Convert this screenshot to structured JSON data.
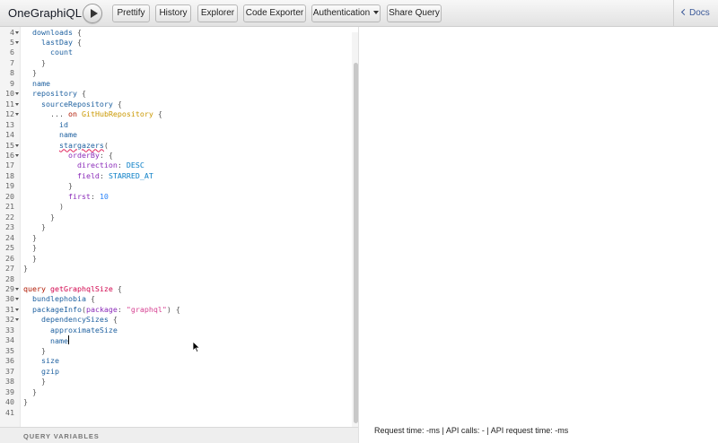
{
  "app": {
    "title": "OneGraphiQL"
  },
  "toolbar": {
    "buttons": [
      {
        "label": "Prettify"
      },
      {
        "label": "History"
      },
      {
        "label": "Explorer"
      },
      {
        "label": "Code Exporter"
      },
      {
        "label": "Authentication"
      },
      {
        "label": "Share Query"
      }
    ],
    "docs_label": "Docs"
  },
  "editor": {
    "lines": [
      {
        "n": "4",
        "fold": true,
        "indent": 1,
        "tokens": [
          [
            "field",
            "downloads"
          ],
          [
            "punct",
            " {"
          ]
        ]
      },
      {
        "n": "5",
        "fold": true,
        "indent": 2,
        "tokens": [
          [
            "field",
            "lastDay"
          ],
          [
            "punct",
            " {"
          ]
        ]
      },
      {
        "n": "6",
        "fold": false,
        "indent": 3,
        "tokens": [
          [
            "field",
            "count"
          ]
        ]
      },
      {
        "n": "7",
        "fold": false,
        "indent": 2,
        "tokens": [
          [
            "punct",
            "}"
          ]
        ]
      },
      {
        "n": "8",
        "fold": false,
        "indent": 1,
        "tokens": [
          [
            "punct",
            "}"
          ]
        ]
      },
      {
        "n": "9",
        "fold": false,
        "indent": 1,
        "tokens": [
          [
            "field",
            "name"
          ]
        ]
      },
      {
        "n": "10",
        "fold": true,
        "indent": 1,
        "tokens": [
          [
            "field",
            "repository"
          ],
          [
            "punct",
            " {"
          ]
        ]
      },
      {
        "n": "11",
        "fold": true,
        "indent": 2,
        "tokens": [
          [
            "field",
            "sourceRepository"
          ],
          [
            "punct",
            " {"
          ]
        ]
      },
      {
        "n": "12",
        "fold": true,
        "indent": 3,
        "tokens": [
          [
            "punct",
            "... "
          ],
          [
            "keyword",
            "on"
          ],
          [
            "punct",
            " "
          ],
          [
            "type",
            "GitHubRepository"
          ],
          [
            "punct",
            " {"
          ]
        ]
      },
      {
        "n": "13",
        "fold": false,
        "indent": 4,
        "tokens": [
          [
            "field",
            "id"
          ]
        ]
      },
      {
        "n": "14",
        "fold": false,
        "indent": 4,
        "tokens": [
          [
            "field",
            "name"
          ]
        ]
      },
      {
        "n": "15",
        "fold": true,
        "indent": 4,
        "tokens": [
          [
            "field-spell",
            "stargazers"
          ],
          [
            "punct",
            "("
          ]
        ]
      },
      {
        "n": "16",
        "fold": true,
        "indent": 5,
        "tokens": [
          [
            "attr",
            "orderBy"
          ],
          [
            "punct",
            ": {"
          ]
        ]
      },
      {
        "n": "17",
        "fold": false,
        "indent": 6,
        "tokens": [
          [
            "attr",
            "direction"
          ],
          [
            "punct",
            ": "
          ],
          [
            "enum",
            "DESC"
          ]
        ]
      },
      {
        "n": "18",
        "fold": false,
        "indent": 6,
        "tokens": [
          [
            "attr",
            "field"
          ],
          [
            "punct",
            ": "
          ],
          [
            "enum",
            "STARRED_AT"
          ]
        ]
      },
      {
        "n": "19",
        "fold": false,
        "indent": 5,
        "tokens": [
          [
            "punct",
            "}"
          ]
        ]
      },
      {
        "n": "20",
        "fold": false,
        "indent": 5,
        "tokens": [
          [
            "attr",
            "first"
          ],
          [
            "punct",
            ": "
          ],
          [
            "number",
            "10"
          ]
        ]
      },
      {
        "n": "21",
        "fold": false,
        "indent": 4,
        "tokens": [
          [
            "punct",
            ")"
          ]
        ]
      },
      {
        "n": "22",
        "fold": false,
        "indent": 3,
        "tokens": [
          [
            "punct",
            "}"
          ]
        ]
      },
      {
        "n": "23",
        "fold": false,
        "indent": 2,
        "tokens": [
          [
            "punct",
            "}"
          ]
        ]
      },
      {
        "n": "24",
        "fold": false,
        "indent": 1,
        "tokens": [
          [
            "punct",
            "}"
          ]
        ]
      },
      {
        "n": "25",
        "fold": false,
        "indent": 1,
        "tokens": [
          [
            "punct",
            "}"
          ]
        ]
      },
      {
        "n": "26",
        "fold": false,
        "indent": 1,
        "tokens": [
          [
            "punct",
            "}"
          ]
        ]
      },
      {
        "n": "27",
        "fold": false,
        "indent": 0,
        "tokens": [
          [
            "punct",
            "}"
          ]
        ]
      },
      {
        "n": "28",
        "fold": false,
        "indent": 0,
        "tokens": []
      },
      {
        "n": "29",
        "fold": true,
        "indent": 0,
        "tokens": [
          [
            "keyword",
            "query"
          ],
          [
            "punct",
            " "
          ],
          [
            "def",
            "getGraphqlSize"
          ],
          [
            "punct",
            " {"
          ]
        ]
      },
      {
        "n": "30",
        "fold": true,
        "indent": 1,
        "tokens": [
          [
            "field",
            "bundlephobia"
          ],
          [
            "punct",
            " {"
          ]
        ]
      },
      {
        "n": "31",
        "fold": true,
        "indent": 1,
        "tokens": [
          [
            "field",
            "packageInfo"
          ],
          [
            "punct",
            "("
          ],
          [
            "attr",
            "package"
          ],
          [
            "punct",
            ": "
          ],
          [
            "string",
            "\"graphql\""
          ],
          [
            "punct",
            ") {"
          ]
        ]
      },
      {
        "n": "32",
        "fold": true,
        "indent": 2,
        "tokens": [
          [
            "field",
            "dependencySizes"
          ],
          [
            "punct",
            " {"
          ]
        ]
      },
      {
        "n": "33",
        "fold": false,
        "indent": 3,
        "tokens": [
          [
            "field",
            "approximateSize"
          ]
        ]
      },
      {
        "n": "34",
        "fold": false,
        "indent": 3,
        "tokens": [
          [
            "field",
            "name"
          ],
          [
            "cursor",
            ""
          ]
        ]
      },
      {
        "n": "35",
        "fold": false,
        "indent": 2,
        "tokens": [
          [
            "punct",
            "}"
          ]
        ]
      },
      {
        "n": "36",
        "fold": false,
        "indent": 2,
        "tokens": [
          [
            "field",
            "size"
          ]
        ]
      },
      {
        "n": "37",
        "fold": false,
        "indent": 2,
        "tokens": [
          [
            "field",
            "gzip"
          ]
        ]
      },
      {
        "n": "38",
        "fold": false,
        "indent": 2,
        "tokens": [
          [
            "punct",
            "}"
          ]
        ]
      },
      {
        "n": "39",
        "fold": false,
        "indent": 1,
        "tokens": [
          [
            "punct",
            "}"
          ]
        ]
      },
      {
        "n": "40",
        "fold": false,
        "indent": 0,
        "tokens": [
          [
            "punct",
            "}"
          ]
        ]
      },
      {
        "n": "41",
        "fold": false,
        "indent": 0,
        "tokens": []
      }
    ]
  },
  "query_variables": {
    "label": "QUERY VARIABLES"
  },
  "result": {
    "status": "Request time: -ms | API calls: - | API request time: -ms"
  }
}
